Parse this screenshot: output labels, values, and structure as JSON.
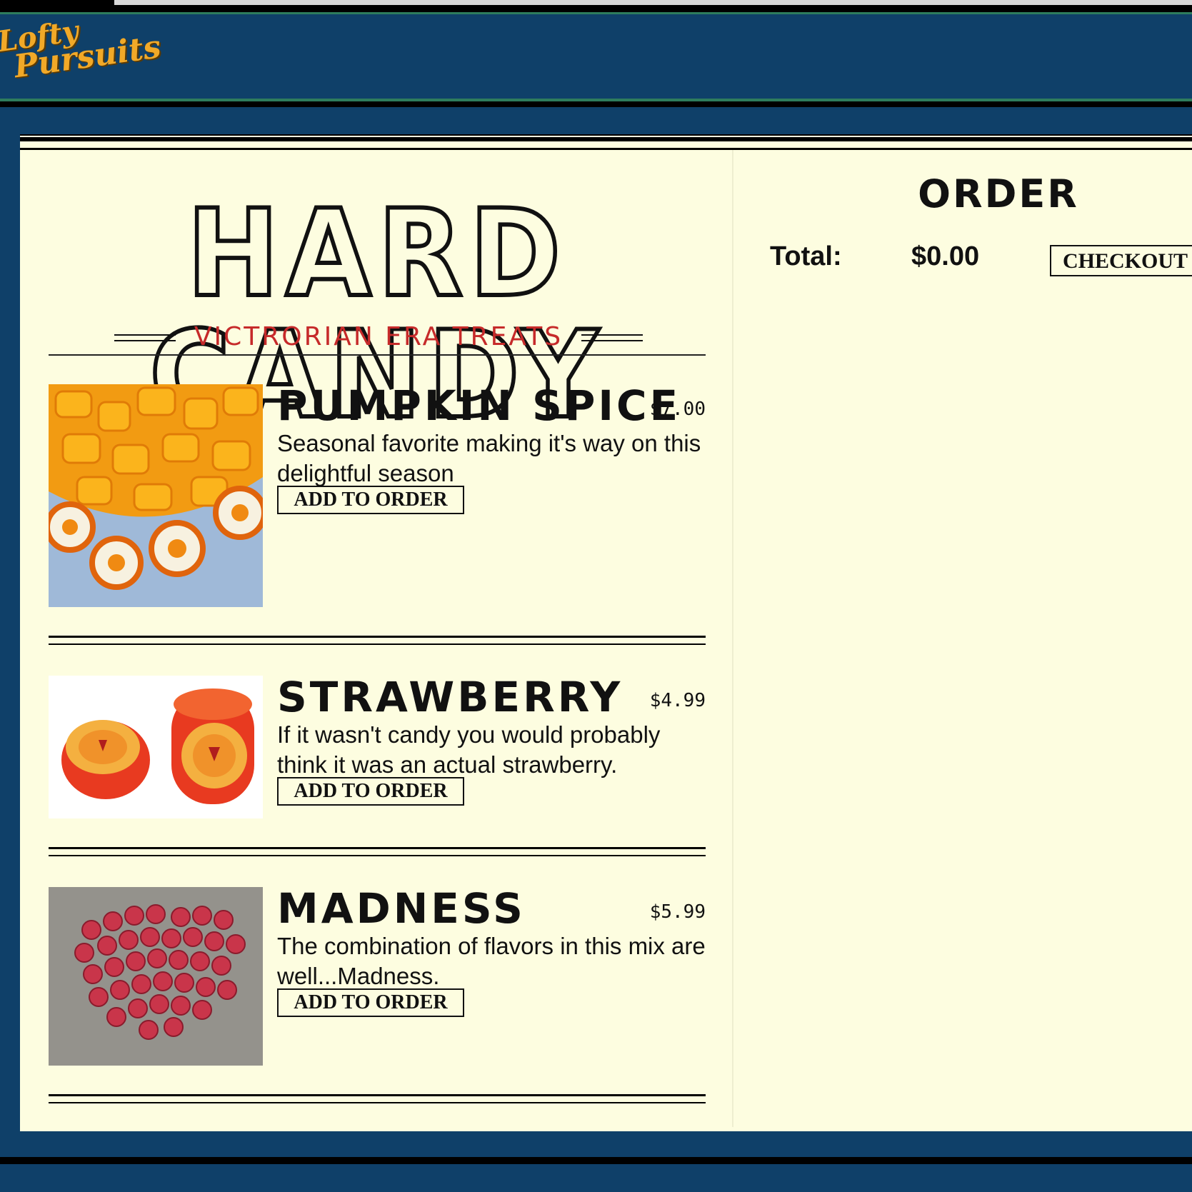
{
  "brand": {
    "logo_line1": "Lofty",
    "logo_line2": "Pursuits"
  },
  "catalog": {
    "title": "HARD CANDY",
    "subtitle": "VICTRORIAN ERA TREATS",
    "add_label": "ADD TO ORDER",
    "items": [
      {
        "name": "PUMPKIN SPICE",
        "price": "$7.00",
        "description": "Seasonal favorite making it's way on this delightful season"
      },
      {
        "name": "STRAWBERRY",
        "price": "$4.99",
        "description": "If it wasn't candy you would probably think it was an actual strawberry."
      },
      {
        "name": "MADNESS",
        "price": "$5.99",
        "description": "The combination of flavors in this mix are well...Madness."
      }
    ]
  },
  "order": {
    "title": "ORDER",
    "total_label": "Total:",
    "total_value": "$0.00",
    "checkout_label": "CHECKOUT"
  },
  "colors": {
    "background": "#0f4069",
    "panel": "#fdfde0",
    "accent_red": "#c62a2a",
    "logo_gold": "#f1a928"
  }
}
